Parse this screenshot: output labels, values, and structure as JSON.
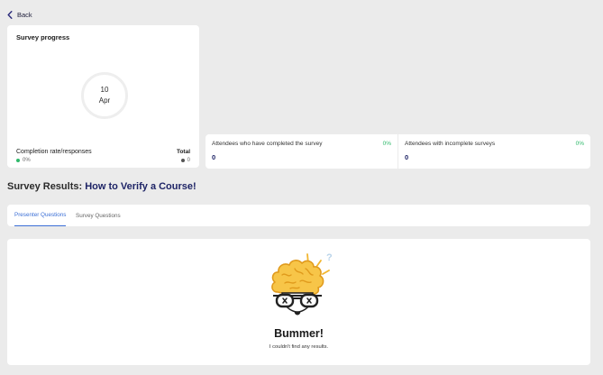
{
  "back": {
    "label": "Back",
    "icon": "chevron-left-icon"
  },
  "progress": {
    "title": "Survey progress",
    "date_day": "10",
    "date_month": "Apr",
    "completion_label": "Completion rate/responses",
    "completion_value": "0%",
    "total_label": "Total",
    "total_value": "0"
  },
  "stats": [
    {
      "label": "Attendees who have completed the survey",
      "percent": "0%",
      "count": "0"
    },
    {
      "label": "Attendees with incomplete surveys",
      "percent": "0%",
      "count": "0"
    }
  ],
  "results": {
    "heading_prefix": "Survey Results: ",
    "course_name": "How to Verify a Course!"
  },
  "tabs": [
    {
      "label": "Presenter Questions",
      "active": true
    },
    {
      "label": "Survey Questions",
      "active": false
    }
  ],
  "empty_state": {
    "title": "Bummer!",
    "message": "I couldn't find any results.",
    "illustration": "confused-brain-icon"
  },
  "colors": {
    "accent_blue": "#3b6fd6",
    "navy": "#1e2466",
    "success_green": "#2fb96b",
    "brain_yellow": "#f2b630"
  }
}
